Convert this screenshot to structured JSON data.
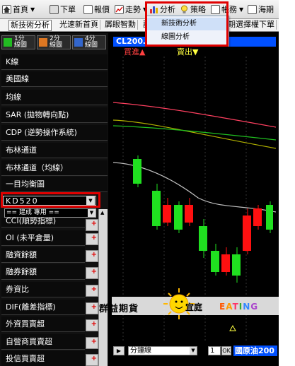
{
  "menubar": {
    "items": [
      {
        "label": "首頁",
        "icon": "home-icon",
        "caret": "▼"
      },
      {
        "label": "下單",
        "icon": "order-icon"
      },
      {
        "label": "報價",
        "icon": "quote-icon"
      },
      {
        "label": "走勢",
        "icon": "trend-icon",
        "caret": "▼"
      },
      {
        "label": "分析",
        "icon": "analysis-icon"
      },
      {
        "label": "策略",
        "icon": "lightbulb-icon"
      },
      {
        "label": "帳務",
        "icon": "account-icon",
        "caret": "▼"
      },
      {
        "label": "海期",
        "icon": "overseas-icon"
      }
    ]
  },
  "tabs": [
    {
      "label": "新技術分析"
    },
    {
      "label": "光速新首頁"
    },
    {
      "label": "羼眼智勳"
    },
    {
      "label": "副"
    },
    {
      "label": "期選擇權下單"
    }
  ],
  "dropdown": {
    "items": [
      "新技術分析",
      "線圖分析"
    ]
  },
  "left_panel": {
    "timeframes": [
      {
        "label_top": "1分",
        "label_bottom": "線圖",
        "color": "#22bb22"
      },
      {
        "label_top": "2分",
        "label_bottom": "線圖",
        "color": "#dd7722"
      },
      {
        "label_top": "4分",
        "label_bottom": "線圖",
        "color": "#3366cc"
      }
    ],
    "indicators_top": [
      "K線",
      "美國線",
      "均線",
      "SAR (拋物轉向點)",
      "CDP (逆勢操作系統)",
      "布林通道",
      "布林通道（均線）",
      "一目均衡圖"
    ],
    "selected_indicator": "KD520",
    "filter_select": "== 建成 專用 ==",
    "indicators_bottom": [
      "CCI(順勢指標)",
      "OI (未平倉量)",
      "融資餘額",
      "融券餘額",
      "券資比",
      "DIF(離差指標)",
      "外資買賣超",
      "自營商買賣超",
      "投信買賣超"
    ]
  },
  "chart": {
    "header": "CL200… …001",
    "buy_label": "買進▲",
    "sell_label": "賣出▼"
  },
  "bottom_bar": {
    "nav": "▶",
    "period": "分鐘線",
    "count": "1",
    "ok": "OK",
    "symbol": "國原油200"
  },
  "watermark": {
    "left_text": "群益期貨",
    "right_text": "宜庭",
    "brand": "EATING"
  },
  "colors": {
    "highlight_border": "#e00000",
    "up_candle": "#ff1010",
    "down_candle": "#10e010",
    "header_blue": "#0050ff"
  }
}
